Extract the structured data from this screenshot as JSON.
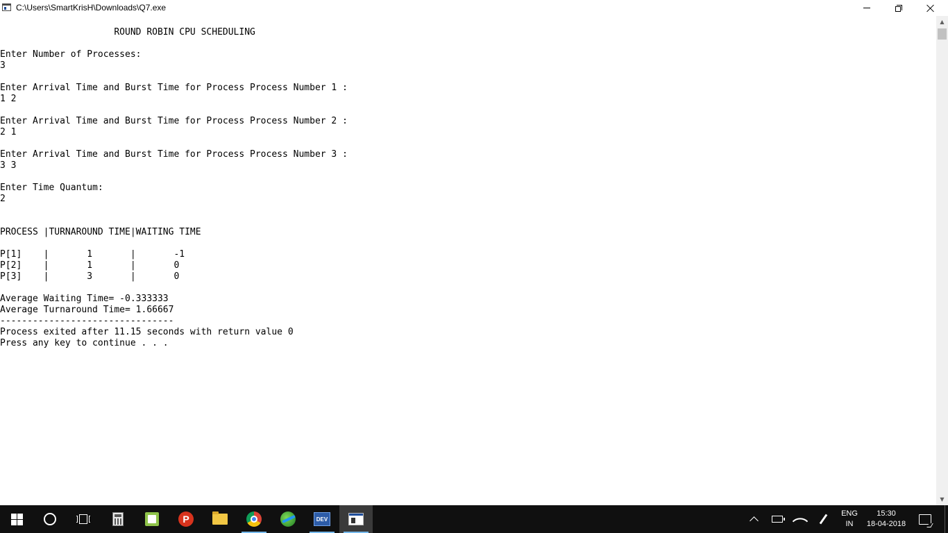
{
  "window": {
    "title": "C:\\Users\\SmartKrisH\\Downloads\\Q7.exe",
    "icon": "console-window-icon",
    "controls": [
      "minimize",
      "restore",
      "close"
    ]
  },
  "console": {
    "lines": [
      "                     ROUND ROBIN CPU SCHEDULING",
      "",
      "Enter Number of Processes:",
      "3",
      "",
      "Enter Arrival Time and Burst Time for Process Process Number 1 :",
      "1 2",
      "",
      "Enter Arrival Time and Burst Time for Process Process Number 2 :",
      "2 1",
      "",
      "Enter Arrival Time and Burst Time for Process Process Number 3 :",
      "3 3",
      "",
      "Enter Time Quantum:",
      "2",
      "",
      "",
      "PROCESS |TURNAROUND TIME|WAITING TIME",
      "",
      "P[1]    |       1       |       -1",
      "P[2]    |       1       |       0",
      "P[3]    |       3       |       0",
      "",
      "Average Waiting Time= -0.333333",
      "Average Turnaround Time= 1.66667",
      "--------------------------------",
      "Process exited after 11.15 seconds with return value 0",
      "Press any key to continue . . ."
    ]
  },
  "taskbar": {
    "apps": [
      {
        "name": "start",
        "icon": "windows-logo-icon"
      },
      {
        "name": "search",
        "icon": "cortana-icon"
      },
      {
        "name": "task-view",
        "icon": "task-view-icon"
      },
      {
        "name": "calculator",
        "icon": "calculator-icon"
      },
      {
        "name": "notepad-plus-plus",
        "icon": "notepadpp-icon"
      },
      {
        "name": "ps",
        "icon": "ps-app-icon",
        "label": "P"
      },
      {
        "name": "file-explorer",
        "icon": "folder-icon"
      },
      {
        "name": "chrome",
        "icon": "chrome-icon"
      },
      {
        "name": "idm",
        "icon": "globe-download-icon"
      },
      {
        "name": "devcpp",
        "icon": "devcpp-icon",
        "label": "DEV"
      },
      {
        "name": "console",
        "icon": "console-app-icon"
      }
    ],
    "tray": {
      "language_top": "ENG",
      "language_bottom": "IN",
      "time": "15:30",
      "date": "18-04-2018"
    }
  }
}
